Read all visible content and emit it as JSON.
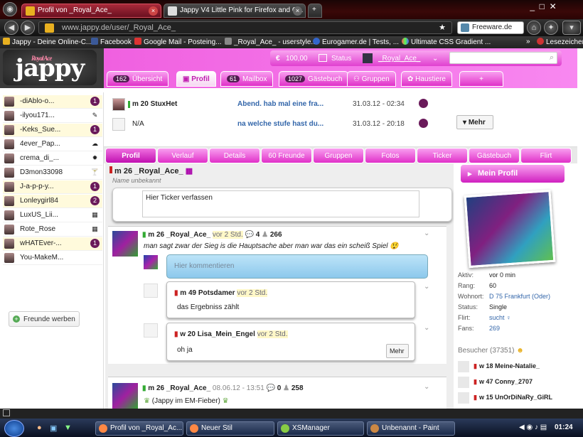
{
  "tabs": [
    {
      "title": "Profil von _Royal_Ace_",
      "active": true
    },
    {
      "title": "Jappy V4 Little Pink for Firefox and C...",
      "active": false
    }
  ],
  "url": "www.jappy.de/user/_Royal_Ace_",
  "search_engine": "Freeware.de",
  "bookmarks": [
    "Jappy - Deine Online-C...",
    "Facebook",
    "Google Mail - Posteing...",
    "_Royal_Ace_ - userstyle...",
    "Eurogamer.de | Tests, ...",
    "Ultimate CSS Gradient ...",
    "Lesezeichen"
  ],
  "header": {
    "logo_text": "jappy",
    "logo_sub": "Royal Ace",
    "coins": "100,00",
    "status_label": "Status",
    "username": "_Royal_Ace_"
  },
  "nav": [
    {
      "count": "162",
      "label": "Übersicht"
    },
    {
      "count": "",
      "label": "Profil"
    },
    {
      "count": "61",
      "label": "Mailbox"
    },
    {
      "count": "1027",
      "label": "Gästebuch"
    },
    {
      "count": "",
      "label": "Gruppen"
    },
    {
      "count": "",
      "label": "Haustiere"
    },
    {
      "count": "",
      "label": "+"
    }
  ],
  "friends": [
    {
      "name": "-diAblo-o...",
      "status": "1",
      "hl": true
    },
    {
      "name": "-ilyou171...",
      "status": "✎",
      "hl": false
    },
    {
      "name": "-Keks_Sue...",
      "status": "1",
      "hl": true
    },
    {
      "name": "4ever_Pap...",
      "status": "☁",
      "hl": false
    },
    {
      "name": "crema_di_...",
      "status": "✹",
      "hl": false
    },
    {
      "name": "D3mon33098",
      "status": "🍸",
      "hl": false
    },
    {
      "name": "J-a-p-p-y...",
      "status": "1",
      "hl": true
    },
    {
      "name": "Lonleygirl84",
      "status": "2",
      "hl": true
    },
    {
      "name": "LuxUS_Lii...",
      "status": "▦",
      "hl": false
    },
    {
      "name": "Rote_Rose",
      "status": "▦",
      "hl": false
    },
    {
      "name": "wHATEver-...",
      "status": "1",
      "hl": true
    },
    {
      "name": "You-MakeM...",
      "status": "",
      "hl": false
    }
  ],
  "invite_label": "Freunde werben",
  "messages": [
    {
      "user": "m 20 StuxHet",
      "text": "Abend. hab mal eine fra...",
      "date": "31.03.12 - 02:34"
    },
    {
      "user": "N/A",
      "text": "na welche stufe hast du...",
      "date": "31.03.12 - 20:18"
    }
  ],
  "more_label": "Mehr",
  "profile_tabs": [
    "Profil",
    "Verlauf",
    "Details",
    "60 Freunde",
    "Gruppen",
    "Fotos",
    "Ticker",
    "Gästebuch",
    "Flirt"
  ],
  "profile": {
    "name": "m 26 _Royal_Ace_",
    "subtitle": "Name unbekannt",
    "ticker_placeholder": "Hier Ticker verfassen",
    "my_profile": "Mein Profil",
    "details": [
      {
        "k": "Aktiv:",
        "v": "vor 0 min"
      },
      {
        "k": "Rang:",
        "v": "60"
      },
      {
        "k": "Wohnort:",
        "v": "D 75 Frankfurt (Oder)"
      },
      {
        "k": "Status:",
        "v": "Single"
      },
      {
        "k": "Flirt:",
        "v": "sucht ♀"
      },
      {
        "k": "Fans:",
        "v": "269"
      }
    ],
    "visitors_label": "Besucher (37351)",
    "visitors": [
      "w 18 Meine-Natalie_",
      "w 47 Conny_2707",
      "w 15 UnOrDiNaRy_GiRL"
    ]
  },
  "posts": [
    {
      "user": "m 26 _Royal_Ace_",
      "ago": "vor 2 Std.",
      "comments": "4",
      "views": "266",
      "text": "man sagt zwar der Sieg is die Hauptsache aber man war das ein scheiß Spiel",
      "comment_placeholder": "Hier kommentieren",
      "replies": [
        {
          "user": "m 49 Potsdamer",
          "ago": "vor 2 Std.",
          "text": "das Ergebniss zählt"
        },
        {
          "user": "w 20 Lisa_Mein_Engel",
          "ago": "vor 2 Std.",
          "text": "oh ja"
        }
      ],
      "more": "Mehr"
    },
    {
      "user": "m 26 _Royal_Ace_",
      "ago": "08.06.12 - 13:51",
      "comments": "0",
      "views": "258",
      "text": "(Jappy im EM-Fieber)"
    }
  ],
  "taskbar": [
    "Profil von _Royal_Ac...",
    "Neuer Stil",
    "XSManager",
    "Unbenannt - Paint"
  ],
  "clock": "01:24"
}
